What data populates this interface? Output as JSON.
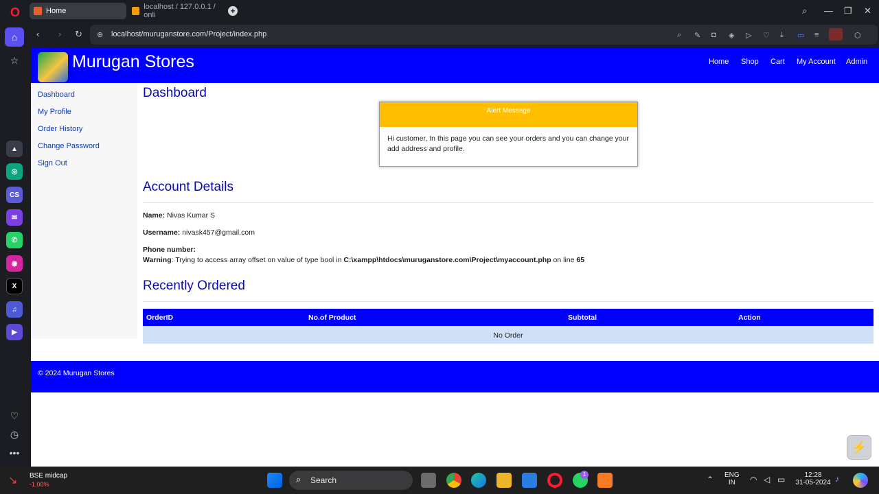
{
  "browser": {
    "tabs": [
      {
        "label": "Home"
      },
      {
        "label": "localhost / 127.0.0.1 / onli"
      }
    ],
    "url": "localhost/muruganstore.com/Project/index.php"
  },
  "site": {
    "brand": "Murugan Stores",
    "nav": [
      "Home",
      "Shop",
      "Cart",
      "My Account",
      "Admin"
    ],
    "sidebar": [
      "Dashboard",
      "My Profile",
      "Order History",
      "Change Password",
      "Sign Out"
    ],
    "dashboard_title": "Dashboard",
    "alert": {
      "title": "Alert Message",
      "body": "Hi customer, In this page you can see your orders and you can change your add address and profile."
    },
    "account": {
      "title": "Account Details",
      "name_label": "Name:",
      "name_value": "Nivas Kumar  S",
      "username_label": "Username:",
      "username_value": "nivask457@gmail.com",
      "phone_label": "Phone number:",
      "warning_label": "Warning",
      "warning_text": ": Trying to access array offset on value of type bool in ",
      "warning_path": "C:\\xampp\\htdocs\\muruganstore.com\\Project\\myaccount.php",
      "warning_online": " on line ",
      "warning_line": "65"
    },
    "recent": {
      "title": "Recently Ordered",
      "columns": [
        "OrderID",
        "No.of Product",
        "Subtotal",
        "Action"
      ],
      "empty_text": "No Order"
    },
    "footer": "© 2024 Murugan Stores"
  },
  "taskbar": {
    "stock_name": "BSE midcap",
    "stock_change": "-1.00%",
    "search_label": "Search",
    "lang_top": "ENG",
    "lang_bottom": "IN",
    "time": "12:28",
    "date": "31-05-2024",
    "whatsapp_badge": "1"
  },
  "colors": {
    "header_blue": "#0000ff",
    "alert_yellow": "#ffbf00",
    "table_row": "#cfe0f7"
  }
}
